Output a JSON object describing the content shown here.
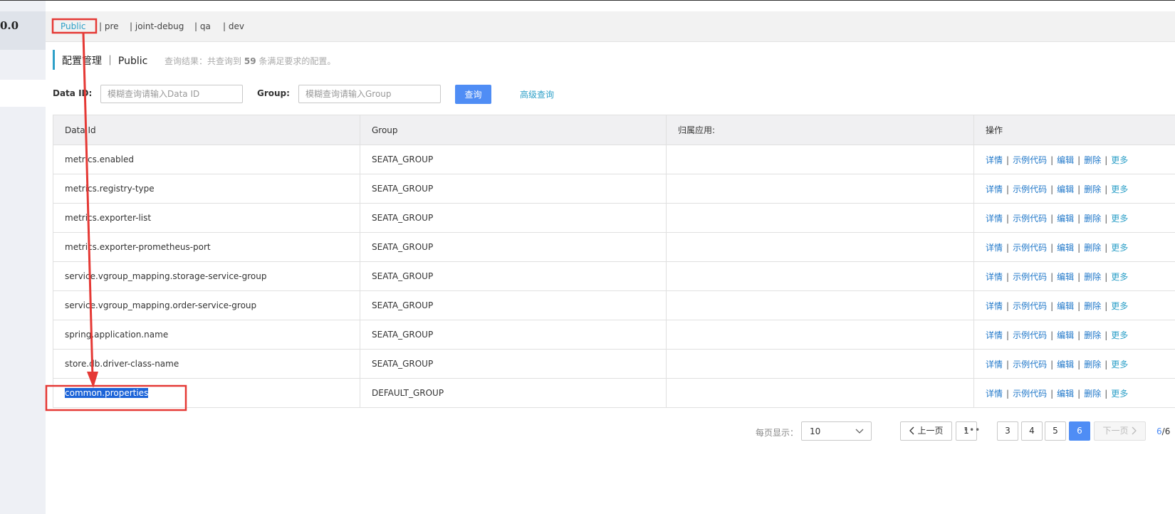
{
  "sidebar": {
    "version_text": "0.0"
  },
  "namespaces": [
    {
      "label": "Public",
      "active": true
    },
    {
      "label": "| pre",
      "active": false
    },
    {
      "label": "| joint-debug",
      "active": false
    },
    {
      "label": "| qa",
      "active": false
    },
    {
      "label": "| dev",
      "active": false
    }
  ],
  "header": {
    "title": "配置管理 ｜ Public",
    "hint_prefix": "查询结果：共查询到",
    "hint_count": "59",
    "hint_suffix": "条满足要求的配置。"
  },
  "filters": {
    "data_id_label": "Data ID:",
    "data_id_placeholder": "模糊查询请输入Data ID",
    "group_label": "Group:",
    "group_placeholder": "模糊查询请输入Group",
    "query_button": "查询",
    "advanced_link": "高级查询"
  },
  "table": {
    "headers": [
      "Data Id",
      "Group",
      "归属应用:",
      "操作"
    ],
    "ops": [
      "详情",
      "示例代码",
      "编辑",
      "删除",
      "更多"
    ],
    "rows": [
      {
        "data_id": "metrics.enabled",
        "group": "SEATA_GROUP",
        "app": ""
      },
      {
        "data_id": "metrics.registry-type",
        "group": "SEATA_GROUP",
        "app": ""
      },
      {
        "data_id": "metrics.exporter-list",
        "group": "SEATA_GROUP",
        "app": ""
      },
      {
        "data_id": "metrics.exporter-prometheus-port",
        "group": "SEATA_GROUP",
        "app": ""
      },
      {
        "data_id": "service.vgroup_mapping.storage-service-group",
        "group": "SEATA_GROUP",
        "app": ""
      },
      {
        "data_id": "service.vgroup_mapping.order-service-group",
        "group": "SEATA_GROUP",
        "app": ""
      },
      {
        "data_id": "spring.application.name",
        "group": "SEATA_GROUP",
        "app": ""
      },
      {
        "data_id": "store.db.driver-class-name",
        "group": "SEATA_GROUP",
        "app": ""
      },
      {
        "data_id": "common.properties",
        "group": "DEFAULT_GROUP",
        "app": "",
        "selected": true
      }
    ]
  },
  "pagination": {
    "page_size_label": "每页显示：",
    "page_size": "10",
    "prev_label": "上一页",
    "next_label": "下一页",
    "pages": [
      "1",
      "3",
      "4",
      "5",
      "6"
    ],
    "ellipsis": "•••",
    "current_page": "6",
    "total_pages": "6"
  },
  "colors": {
    "accent": "#2ea0c8",
    "primary_button": "#4f8df5",
    "annotation": "#e53935",
    "selection": "#1c64d8"
  }
}
